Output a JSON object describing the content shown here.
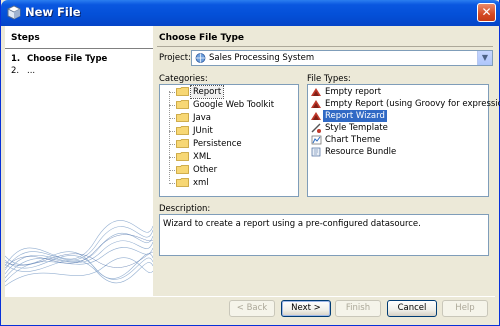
{
  "window": {
    "title": "New File",
    "close_glyph": "✕"
  },
  "steps": {
    "title": "Steps",
    "items": [
      {
        "num": "1.",
        "label": "Choose File Type"
      },
      {
        "num": "2.",
        "label": "..."
      }
    ]
  },
  "main": {
    "title": "Choose File Type",
    "project_label": "Project:",
    "project_value": "Sales Processing System",
    "categories_label": "Categories:",
    "categories": [
      "Report",
      "Google Web Toolkit",
      "Java",
      "JUnit",
      "Persistence",
      "XML",
      "Other",
      "xml"
    ],
    "file_types_label": "File Types:",
    "file_types": [
      {
        "label": "Empty report",
        "icon": "report-icon"
      },
      {
        "label": "Empty Report (using Groovy for expressions)",
        "icon": "report-icon"
      },
      {
        "label": "Report Wizard",
        "icon": "report-icon"
      },
      {
        "label": "Style Template",
        "icon": "style-icon"
      },
      {
        "label": "Chart Theme",
        "icon": "chart-icon"
      },
      {
        "label": "Resource Bundle",
        "icon": "bundle-icon"
      }
    ],
    "description_label": "Description:",
    "description": "Wizard to create a report using a pre-configured datasource."
  },
  "buttons": {
    "back": "< Back",
    "next": "Next >",
    "finish": "Finish",
    "cancel": "Cancel",
    "help": "Help"
  },
  "colors": {
    "title_bar": "#0450d8",
    "selection": "#316ac5",
    "dialog_bg": "#ece9d8"
  }
}
